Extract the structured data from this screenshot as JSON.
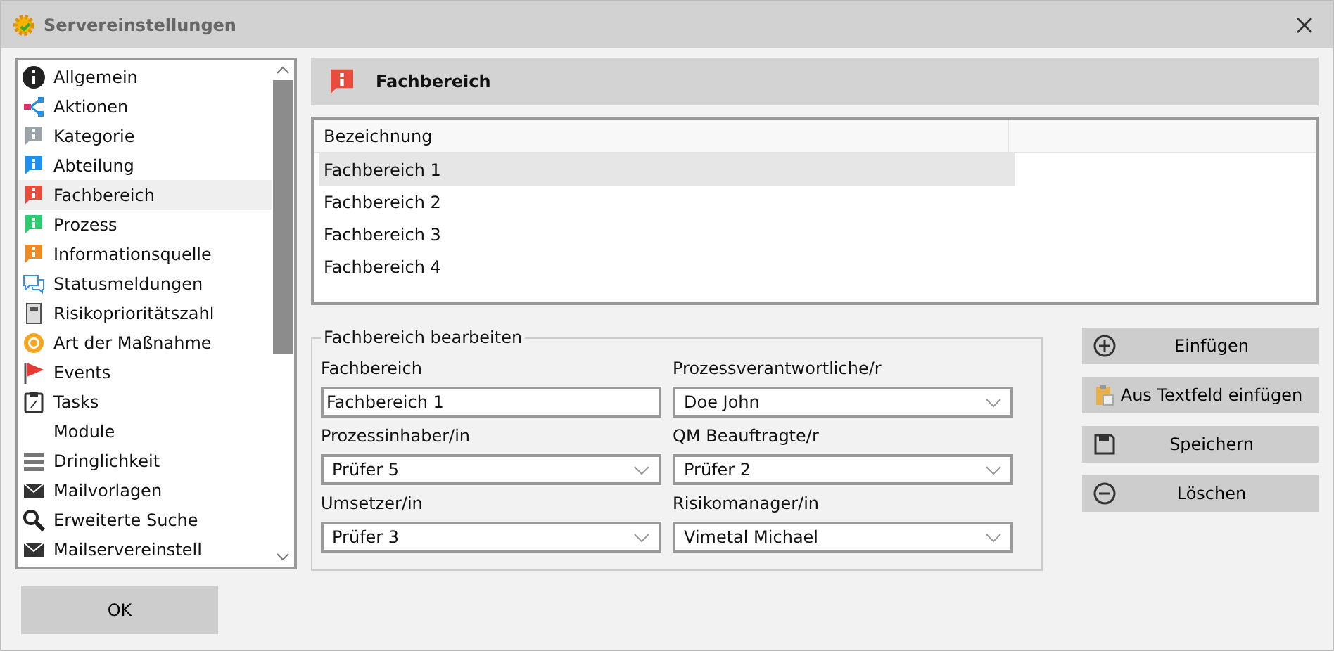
{
  "window": {
    "title": "Servereinstellungen"
  },
  "sidebar": {
    "items": [
      {
        "label": "Allgemein",
        "selected": false
      },
      {
        "label": "Aktionen",
        "selected": false
      },
      {
        "label": "Kategorie",
        "selected": false,
        "color": "#9aa3a8"
      },
      {
        "label": "Abteilung",
        "selected": false,
        "color": "#1e90f0"
      },
      {
        "label": "Fachbereich",
        "selected": true,
        "color": "#e84c3d"
      },
      {
        "label": "Prozess",
        "selected": false,
        "color": "#2ecc71"
      },
      {
        "label": "Informationsquelle",
        "selected": false,
        "color": "#f08a24"
      },
      {
        "label": "Statusmeldungen",
        "selected": false
      },
      {
        "label": "Risikoprioritätszahl",
        "selected": false
      },
      {
        "label": "Art der Maßnahme",
        "selected": false
      },
      {
        "label": "Events",
        "selected": false
      },
      {
        "label": "Tasks",
        "selected": false
      },
      {
        "label": "Module",
        "selected": false
      },
      {
        "label": "Dringlichkeit",
        "selected": false
      },
      {
        "label": "Mailvorlagen",
        "selected": false
      },
      {
        "label": "Erweiterte Suche",
        "selected": false
      },
      {
        "label": "Mailservereinstell",
        "selected": false
      }
    ]
  },
  "header": {
    "title": "Fachbereich"
  },
  "table": {
    "columns": [
      "Bezeichnung"
    ],
    "rows": [
      {
        "cells": [
          "Fachbereich 1"
        ],
        "selected": true
      },
      {
        "cells": [
          "Fachbereich 2"
        ],
        "selected": false
      },
      {
        "cells": [
          "Fachbereich 3"
        ],
        "selected": false
      },
      {
        "cells": [
          "Fachbereich 4"
        ],
        "selected": false
      }
    ]
  },
  "form": {
    "legend": "Fachbereich bearbeiten",
    "fields": [
      {
        "label": "Fachbereich",
        "value": "Fachbereich 1",
        "kind": "text"
      },
      {
        "label": "Prozessverantwortliche/r",
        "value": "Doe John",
        "kind": "select"
      },
      {
        "label": "Prozessinhaber/in",
        "value": "Prüfer 5",
        "kind": "select"
      },
      {
        "label": "QM Beauftragte/r",
        "value": "Prüfer 2",
        "kind": "select"
      },
      {
        "label": "Umsetzer/in",
        "value": "Prüfer 3",
        "kind": "select"
      },
      {
        "label": "Risikomanager/in",
        "value": "Vimetal Michael",
        "kind": "select"
      }
    ]
  },
  "actions": [
    "Einfügen",
    "Aus Textfeld einfügen",
    "Speichern",
    "Löschen"
  ],
  "ok_button": "OK"
}
